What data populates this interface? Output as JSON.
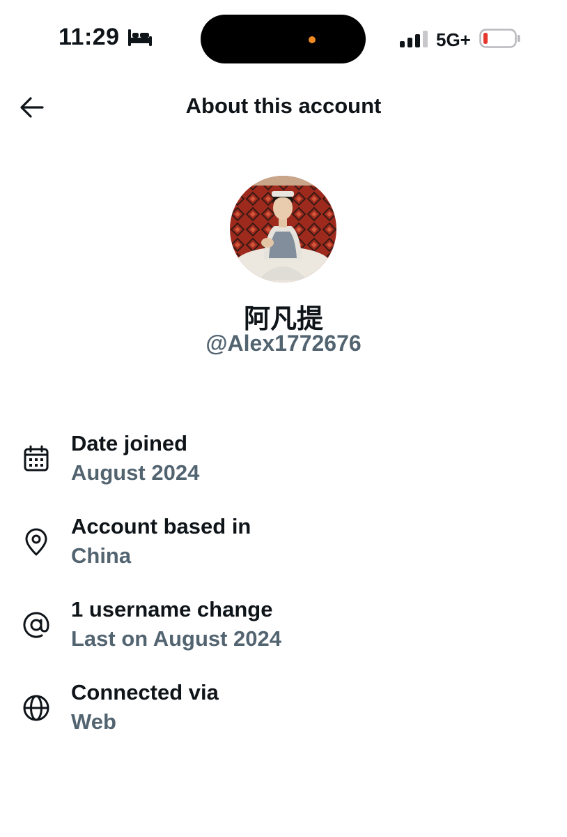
{
  "status_bar": {
    "time": "11:29",
    "network": "5G+",
    "battery_color": "#e5392f",
    "island_dot_color": "#f08a24",
    "icons": [
      "bed-icon",
      "signal-icon",
      "battery-icon"
    ]
  },
  "header": {
    "title": "About this account",
    "back_icon": "arrow-left-icon"
  },
  "profile": {
    "display_name": "阿凡提",
    "handle": "@Alex1772676"
  },
  "info": [
    {
      "icon": "calendar-icon",
      "title": "Date joined",
      "value": "August 2024"
    },
    {
      "icon": "location-pin-icon",
      "title": "Account based in",
      "value": "China"
    },
    {
      "icon": "at-sign-icon",
      "title": "1 username change",
      "value": "Last on August 2024"
    },
    {
      "icon": "globe-icon",
      "title": "Connected via",
      "value": "Web"
    }
  ],
  "colors": {
    "primary_text": "#0f1419",
    "secondary_text": "#536471",
    "background": "#ffffff"
  }
}
